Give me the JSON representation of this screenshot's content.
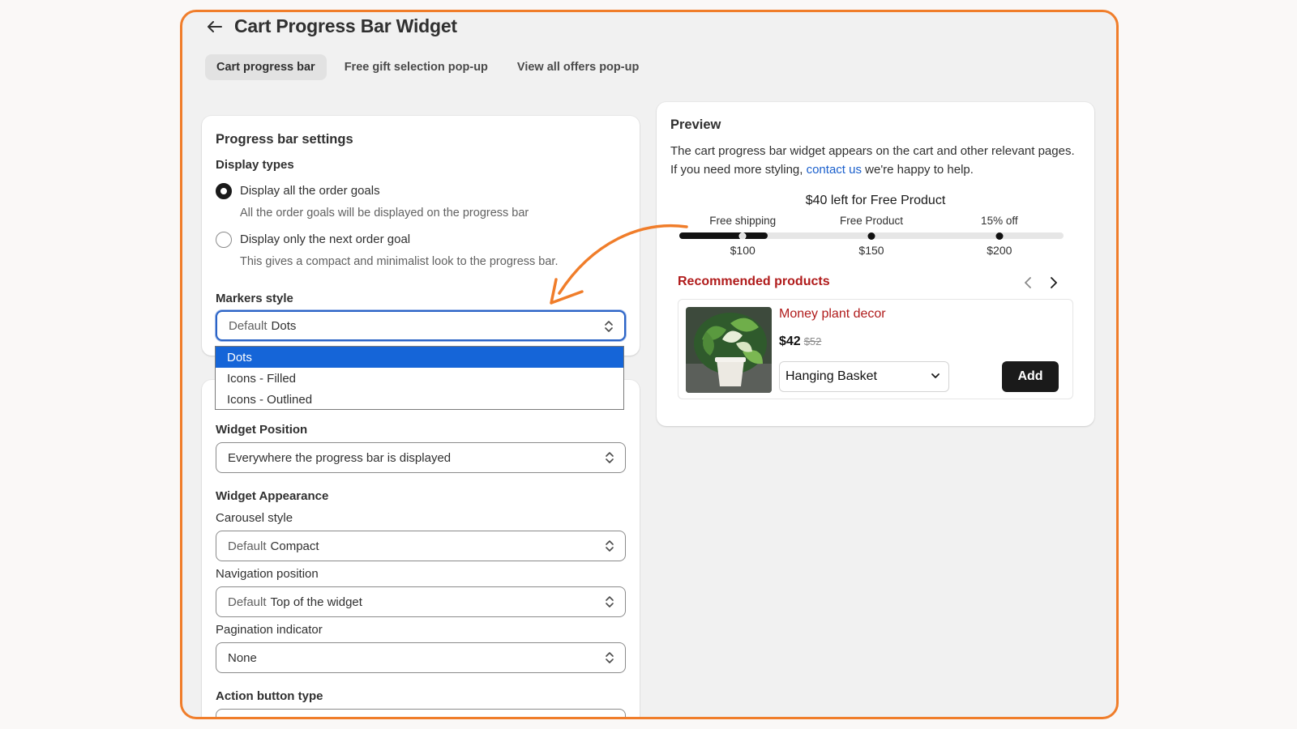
{
  "header": {
    "title": "Cart Progress Bar Widget",
    "back_icon": "arrow-left-icon"
  },
  "tabs": [
    {
      "label": "Cart progress bar",
      "active": true
    },
    {
      "label": "Free gift selection pop-up",
      "active": false
    },
    {
      "label": "View all offers pop-up",
      "active": false
    }
  ],
  "settings": {
    "title": "Progress bar settings",
    "display_types_label": "Display types",
    "options": [
      {
        "label": "Display all the order goals",
        "help": "All the order goals will be displayed on the progress bar",
        "checked": true
      },
      {
        "label": "Display only the next order goal",
        "help": "This gives a compact and minimalist look to the progress bar.",
        "checked": false
      }
    ],
    "markers_label": "Markers style",
    "markers_select": {
      "prefix": "Default",
      "value": "Dots"
    },
    "markers_options": [
      "Dots",
      "Icons - Filled",
      "Icons - Outlined"
    ],
    "widget_position_label": "Widget Position",
    "widget_position_value": "Everywhere the progress bar is displayed",
    "appearance_label": "Widget Appearance",
    "carousel_label": "Carousel style",
    "carousel_select": {
      "prefix": "Default",
      "value": "Compact"
    },
    "navigation_label": "Navigation position",
    "navigation_select": {
      "prefix": "Default",
      "value": "Top of the widget"
    },
    "pagination_label": "Pagination indicator",
    "pagination_value": "None",
    "action_label": "Action button type"
  },
  "preview": {
    "title": "Preview",
    "desc_before": "The cart progress bar widget appears on the cart and other relevant pages. If you need more styling,",
    "desc_link": "contact us",
    "desc_after": "we're happy to help.",
    "progress": {
      "headline": "$40 left for Free Product",
      "fill_fraction": 0.23,
      "goals": [
        {
          "label": "Free shipping",
          "amount": "$100",
          "fraction": 0.165
        },
        {
          "label": "Free Product",
          "amount": "$150",
          "fraction": 0.5
        },
        {
          "label": "15% off",
          "amount": "$200",
          "fraction": 0.833
        }
      ]
    },
    "recommended_title": "Recommended products",
    "product": {
      "name": "Money plant decor",
      "price": "$42",
      "compare_price": "$52",
      "variant": "Hanging Basket",
      "add_label": "Add"
    }
  },
  "colors": {
    "annotation": "#f07d2a",
    "selected_option": "#1565d8",
    "link": "#1a5fcc",
    "recommended": "#b01b1b"
  }
}
